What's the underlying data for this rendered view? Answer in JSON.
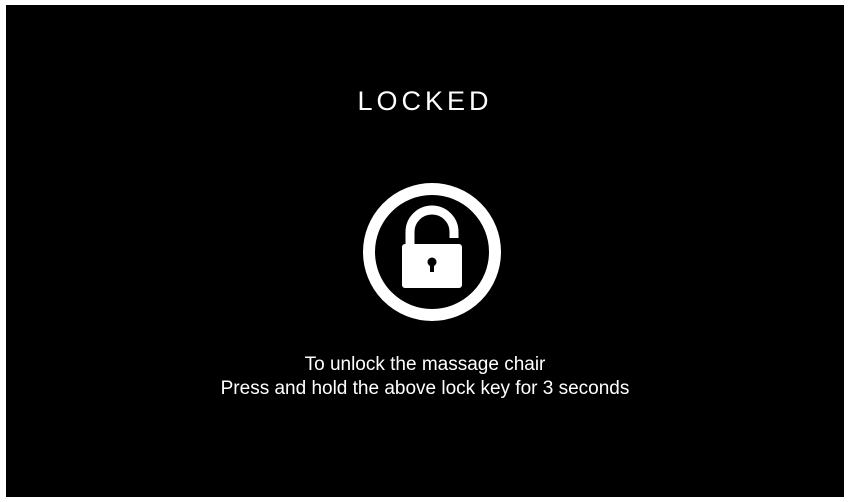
{
  "screen": {
    "title": "LOCKED",
    "lock_key_icon": "padlock-icon",
    "instructions": {
      "line1": "To unlock the massage chair",
      "line2": "Press and hold the above lock key for 3 seconds"
    }
  },
  "colors": {
    "background": "#000000",
    "foreground": "#ffffff"
  }
}
